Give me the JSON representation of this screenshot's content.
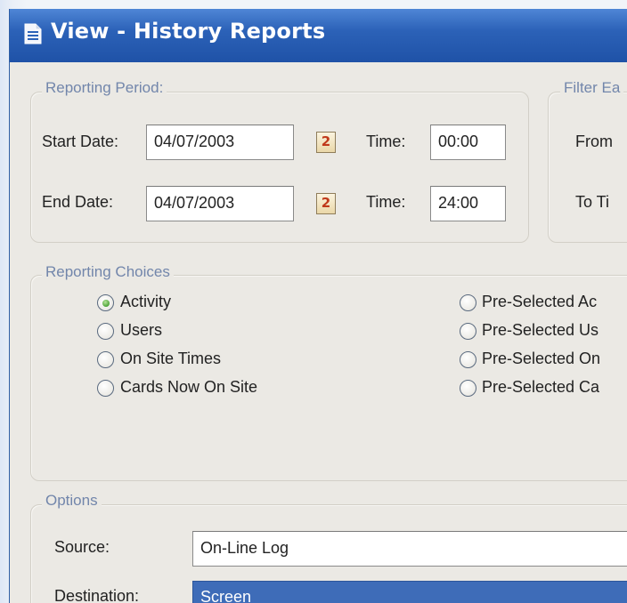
{
  "window": {
    "title": "View - History Reports"
  },
  "reporting_period": {
    "legend": "Reporting Period:",
    "start": {
      "label": "Start Date:",
      "date": "04/07/2003",
      "cal_glyph": "2",
      "time_label": "Time:",
      "time": "00:00"
    },
    "end": {
      "label": "End Date:",
      "date": "04/07/2003",
      "cal_glyph": "2",
      "time_label": "Time:",
      "time": "24:00"
    }
  },
  "filter": {
    "legend": "Filter Ea",
    "from_label": "From",
    "to_label": "To Ti"
  },
  "reporting_choices": {
    "legend": "Reporting Choices",
    "left": [
      {
        "label": "Activity",
        "checked": true
      },
      {
        "label": "Users",
        "checked": false
      },
      {
        "label": "On Site Times",
        "checked": false
      },
      {
        "label": "Cards Now On Site",
        "checked": false
      }
    ],
    "right": [
      {
        "label": "Pre-Selected Ac",
        "checked": false
      },
      {
        "label": "Pre-Selected Us",
        "checked": false
      },
      {
        "label": "Pre-Selected On",
        "checked": false
      },
      {
        "label": "Pre-Selected Ca",
        "checked": false
      }
    ]
  },
  "options": {
    "legend": "Options",
    "source": {
      "label": "Source:",
      "value": "On-Line Log"
    },
    "destination": {
      "label": "Destination:",
      "value": "Screen"
    }
  },
  "colors": {
    "titlebar": "#2c62b8",
    "legend_text": "#7286ab",
    "selection": "#3e6cb8",
    "radio_dot": "#3e9a2a"
  },
  "icons": {
    "title": "document-icon",
    "calendar": "calendar-icon"
  }
}
